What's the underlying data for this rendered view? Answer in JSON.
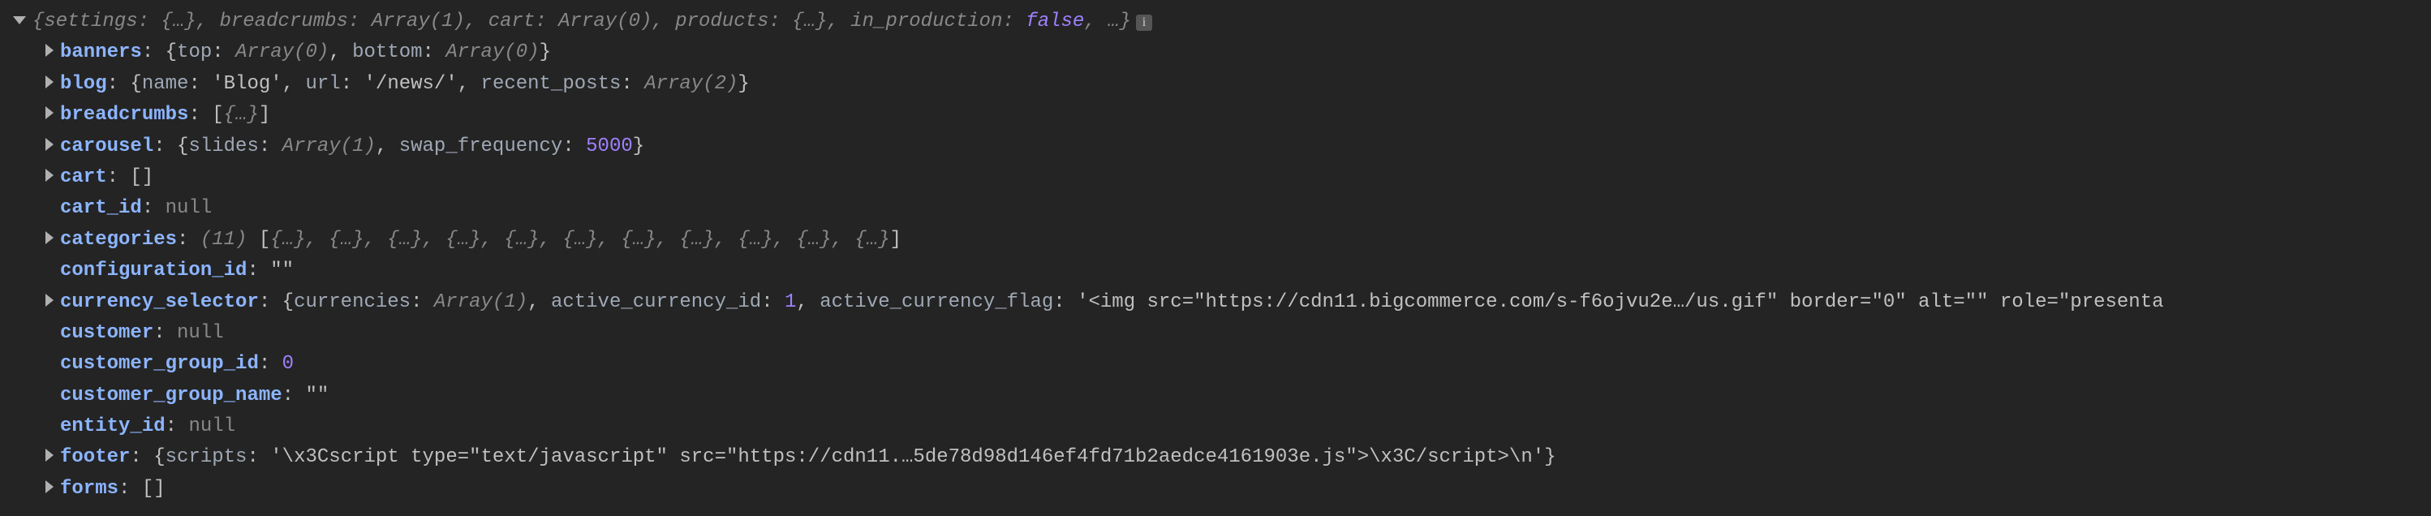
{
  "root": {
    "summary_prefix": "{",
    "summary_parts": [
      {
        "key": "settings",
        "val": "{…}"
      },
      {
        "key": "breadcrumbs",
        "val": "Array(1)"
      },
      {
        "key": "cart",
        "val": "Array(0)"
      },
      {
        "key": "products",
        "val": "{…}"
      },
      {
        "key": "in_production",
        "val": "false",
        "special": true
      }
    ],
    "summary_suffix": ", …}"
  },
  "rows": [
    {
      "key": "banners",
      "arrow": true,
      "parts": [
        {
          "t": "punct",
          "v": ": {"
        },
        {
          "t": "key-dim",
          "v": "top"
        },
        {
          "t": "punct",
          "v": ": "
        },
        {
          "t": "dim",
          "v": "Array(0)"
        },
        {
          "t": "punct",
          "v": ", "
        },
        {
          "t": "key-dim",
          "v": "bottom"
        },
        {
          "t": "punct",
          "v": ": "
        },
        {
          "t": "dim",
          "v": "Array(0)"
        },
        {
          "t": "punct",
          "v": "}"
        }
      ]
    },
    {
      "key": "blog",
      "arrow": true,
      "parts": [
        {
          "t": "punct",
          "v": ": {"
        },
        {
          "t": "key-dim",
          "v": "name"
        },
        {
          "t": "punct",
          "v": ": "
        },
        {
          "t": "string",
          "v": "'Blog'"
        },
        {
          "t": "punct",
          "v": ", "
        },
        {
          "t": "key-dim",
          "v": "url"
        },
        {
          "t": "punct",
          "v": ": "
        },
        {
          "t": "string",
          "v": "'/news/'"
        },
        {
          "t": "punct",
          "v": ", "
        },
        {
          "t": "key-dim",
          "v": "recent_posts"
        },
        {
          "t": "punct",
          "v": ": "
        },
        {
          "t": "dim",
          "v": "Array(2)"
        },
        {
          "t": "punct",
          "v": "}"
        }
      ]
    },
    {
      "key": "breadcrumbs",
      "arrow": true,
      "parts": [
        {
          "t": "punct",
          "v": ": ["
        },
        {
          "t": "dim",
          "v": "{…}"
        },
        {
          "t": "punct",
          "v": "]"
        }
      ]
    },
    {
      "key": "carousel",
      "arrow": true,
      "parts": [
        {
          "t": "punct",
          "v": ": {"
        },
        {
          "t": "key-dim",
          "v": "slides"
        },
        {
          "t": "punct",
          "v": ": "
        },
        {
          "t": "dim",
          "v": "Array(1)"
        },
        {
          "t": "punct",
          "v": ", "
        },
        {
          "t": "key-dim",
          "v": "swap_frequency"
        },
        {
          "t": "punct",
          "v": ": "
        },
        {
          "t": "num",
          "v": "5000"
        },
        {
          "t": "punct",
          "v": "}"
        }
      ]
    },
    {
      "key": "cart",
      "arrow": true,
      "parts": [
        {
          "t": "punct",
          "v": ": []"
        }
      ]
    },
    {
      "key": "cart_id",
      "arrow": false,
      "parts": [
        {
          "t": "punct",
          "v": ": "
        },
        {
          "t": "null",
          "v": "null"
        }
      ]
    },
    {
      "key": "categories",
      "arrow": true,
      "parts": [
        {
          "t": "punct",
          "v": ": "
        },
        {
          "t": "dim",
          "v": "(11) "
        },
        {
          "t": "punct",
          "v": "["
        },
        {
          "t": "dim",
          "v": "{…}, {…}, {…}, {…}, {…}, {…}, {…}, {…}, {…}, {…}, {…}"
        },
        {
          "t": "punct",
          "v": "]"
        }
      ]
    },
    {
      "key": "configuration_id",
      "arrow": false,
      "parts": [
        {
          "t": "punct",
          "v": ": "
        },
        {
          "t": "string",
          "v": "\"\""
        }
      ]
    },
    {
      "key": "currency_selector",
      "arrow": true,
      "parts": [
        {
          "t": "punct",
          "v": ": {"
        },
        {
          "t": "key-dim",
          "v": "currencies"
        },
        {
          "t": "punct",
          "v": ": "
        },
        {
          "t": "dim",
          "v": "Array(1)"
        },
        {
          "t": "punct",
          "v": ", "
        },
        {
          "t": "key-dim",
          "v": "active_currency_id"
        },
        {
          "t": "punct",
          "v": ": "
        },
        {
          "t": "num",
          "v": "1"
        },
        {
          "t": "punct",
          "v": ", "
        },
        {
          "t": "key-dim",
          "v": "active_currency_flag"
        },
        {
          "t": "punct",
          "v": ": "
        },
        {
          "t": "string",
          "v": "'<img src=\"https://cdn11.bigcommerce.com/s-f6ojvu2e…/us.gif\" border=\"0\" alt=\"\" role=\"presenta"
        }
      ]
    },
    {
      "key": "customer",
      "arrow": false,
      "parts": [
        {
          "t": "punct",
          "v": ": "
        },
        {
          "t": "null",
          "v": "null"
        }
      ]
    },
    {
      "key": "customer_group_id",
      "arrow": false,
      "parts": [
        {
          "t": "punct",
          "v": ": "
        },
        {
          "t": "num",
          "v": "0"
        }
      ]
    },
    {
      "key": "customer_group_name",
      "arrow": false,
      "parts": [
        {
          "t": "punct",
          "v": ": "
        },
        {
          "t": "string",
          "v": "\"\""
        }
      ]
    },
    {
      "key": "entity_id",
      "arrow": false,
      "parts": [
        {
          "t": "punct",
          "v": ": "
        },
        {
          "t": "null",
          "v": "null"
        }
      ]
    },
    {
      "key": "footer",
      "arrow": true,
      "parts": [
        {
          "t": "punct",
          "v": ": {"
        },
        {
          "t": "key-dim",
          "v": "scripts"
        },
        {
          "t": "punct",
          "v": ": "
        },
        {
          "t": "string",
          "v": "'\\x3Cscript type=\"text/javascript\" src=\"https://cdn11.…5de78d98d146ef4fd71b2aedce4161903e.js\">\\x3C/script>\\n'"
        },
        {
          "t": "punct",
          "v": "}"
        }
      ]
    },
    {
      "key": "forms",
      "arrow": true,
      "parts": [
        {
          "t": "punct",
          "v": ": []"
        }
      ]
    }
  ]
}
